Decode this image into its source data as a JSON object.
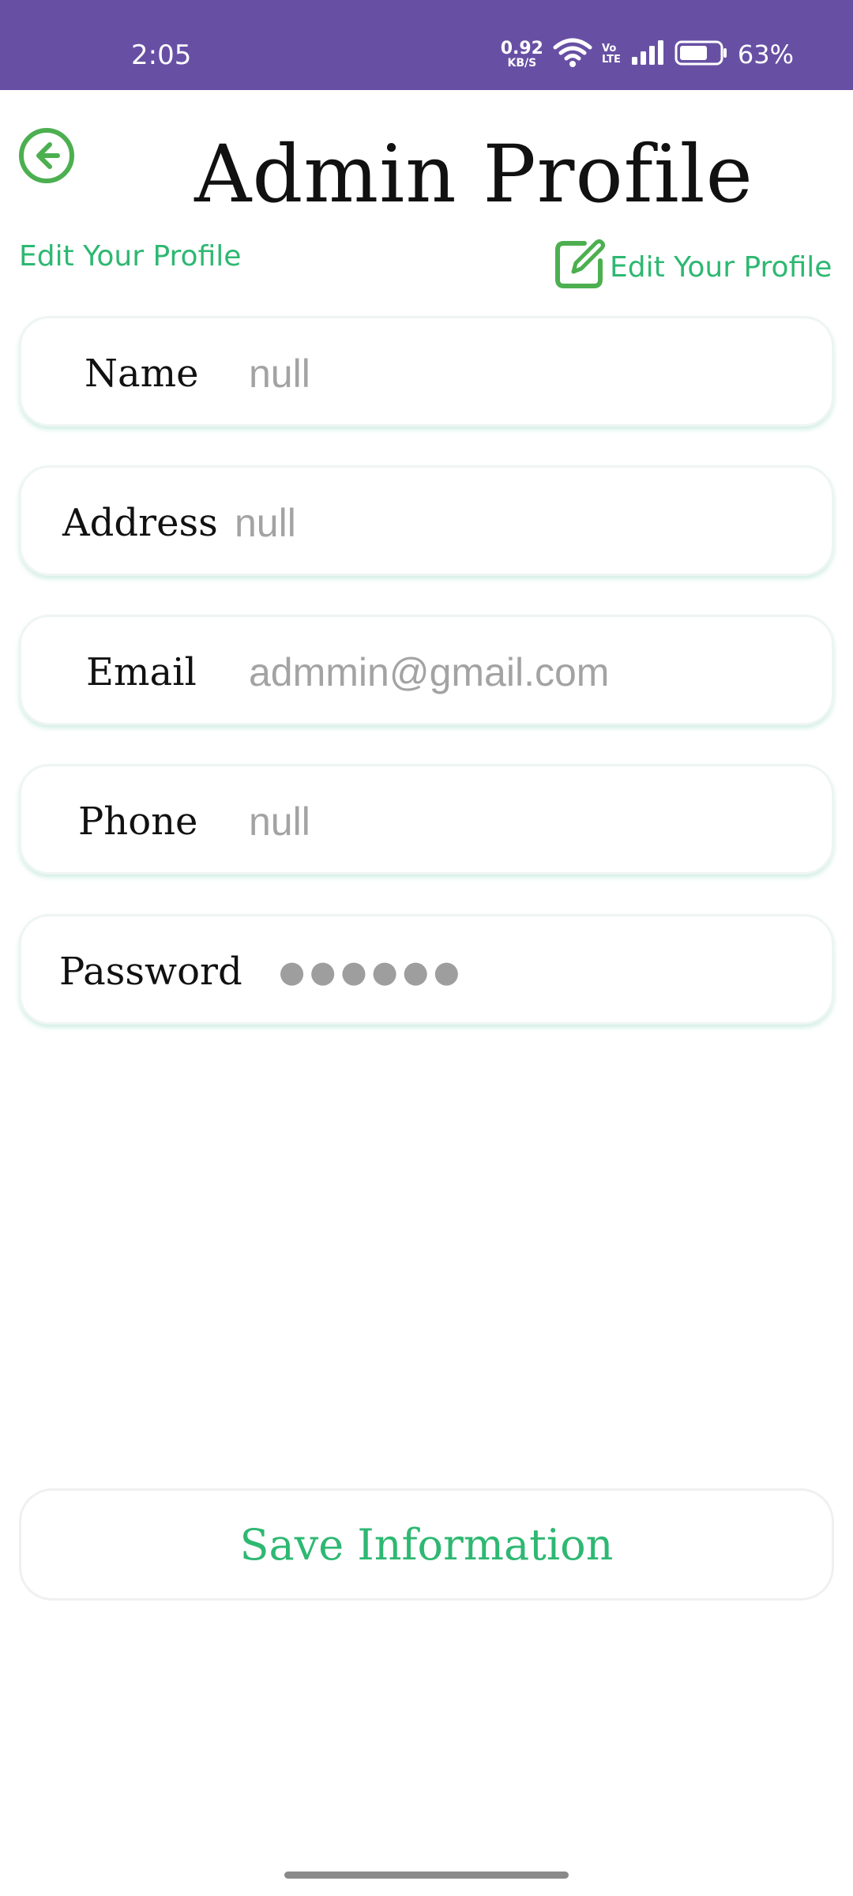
{
  "status_bar": {
    "time": "2:05",
    "net_speed_value": "0.92",
    "net_speed_unit": "KB/S",
    "volte_top": "Vo",
    "volte_bottom": "LTE",
    "battery_percent": "63%",
    "background_color": "#6750A4"
  },
  "header": {
    "back_icon": "arrow-left-circle-icon",
    "title": "Admin Profile",
    "subtitle": "Edit Your Profile",
    "edit_icon": "edit-square-icon",
    "edit_label": "Edit Your Profile",
    "accent_color": "#2EB872"
  },
  "fields": [
    {
      "label": "Name",
      "value": "null"
    },
    {
      "label": "Address",
      "value": "null"
    },
    {
      "label": "Email",
      "value": "admmin@gmail.com"
    },
    {
      "label": "Phone",
      "value": "null"
    },
    {
      "label": "Password",
      "value": "●●●●●●"
    }
  ],
  "actions": {
    "save_label": "Save Information"
  }
}
